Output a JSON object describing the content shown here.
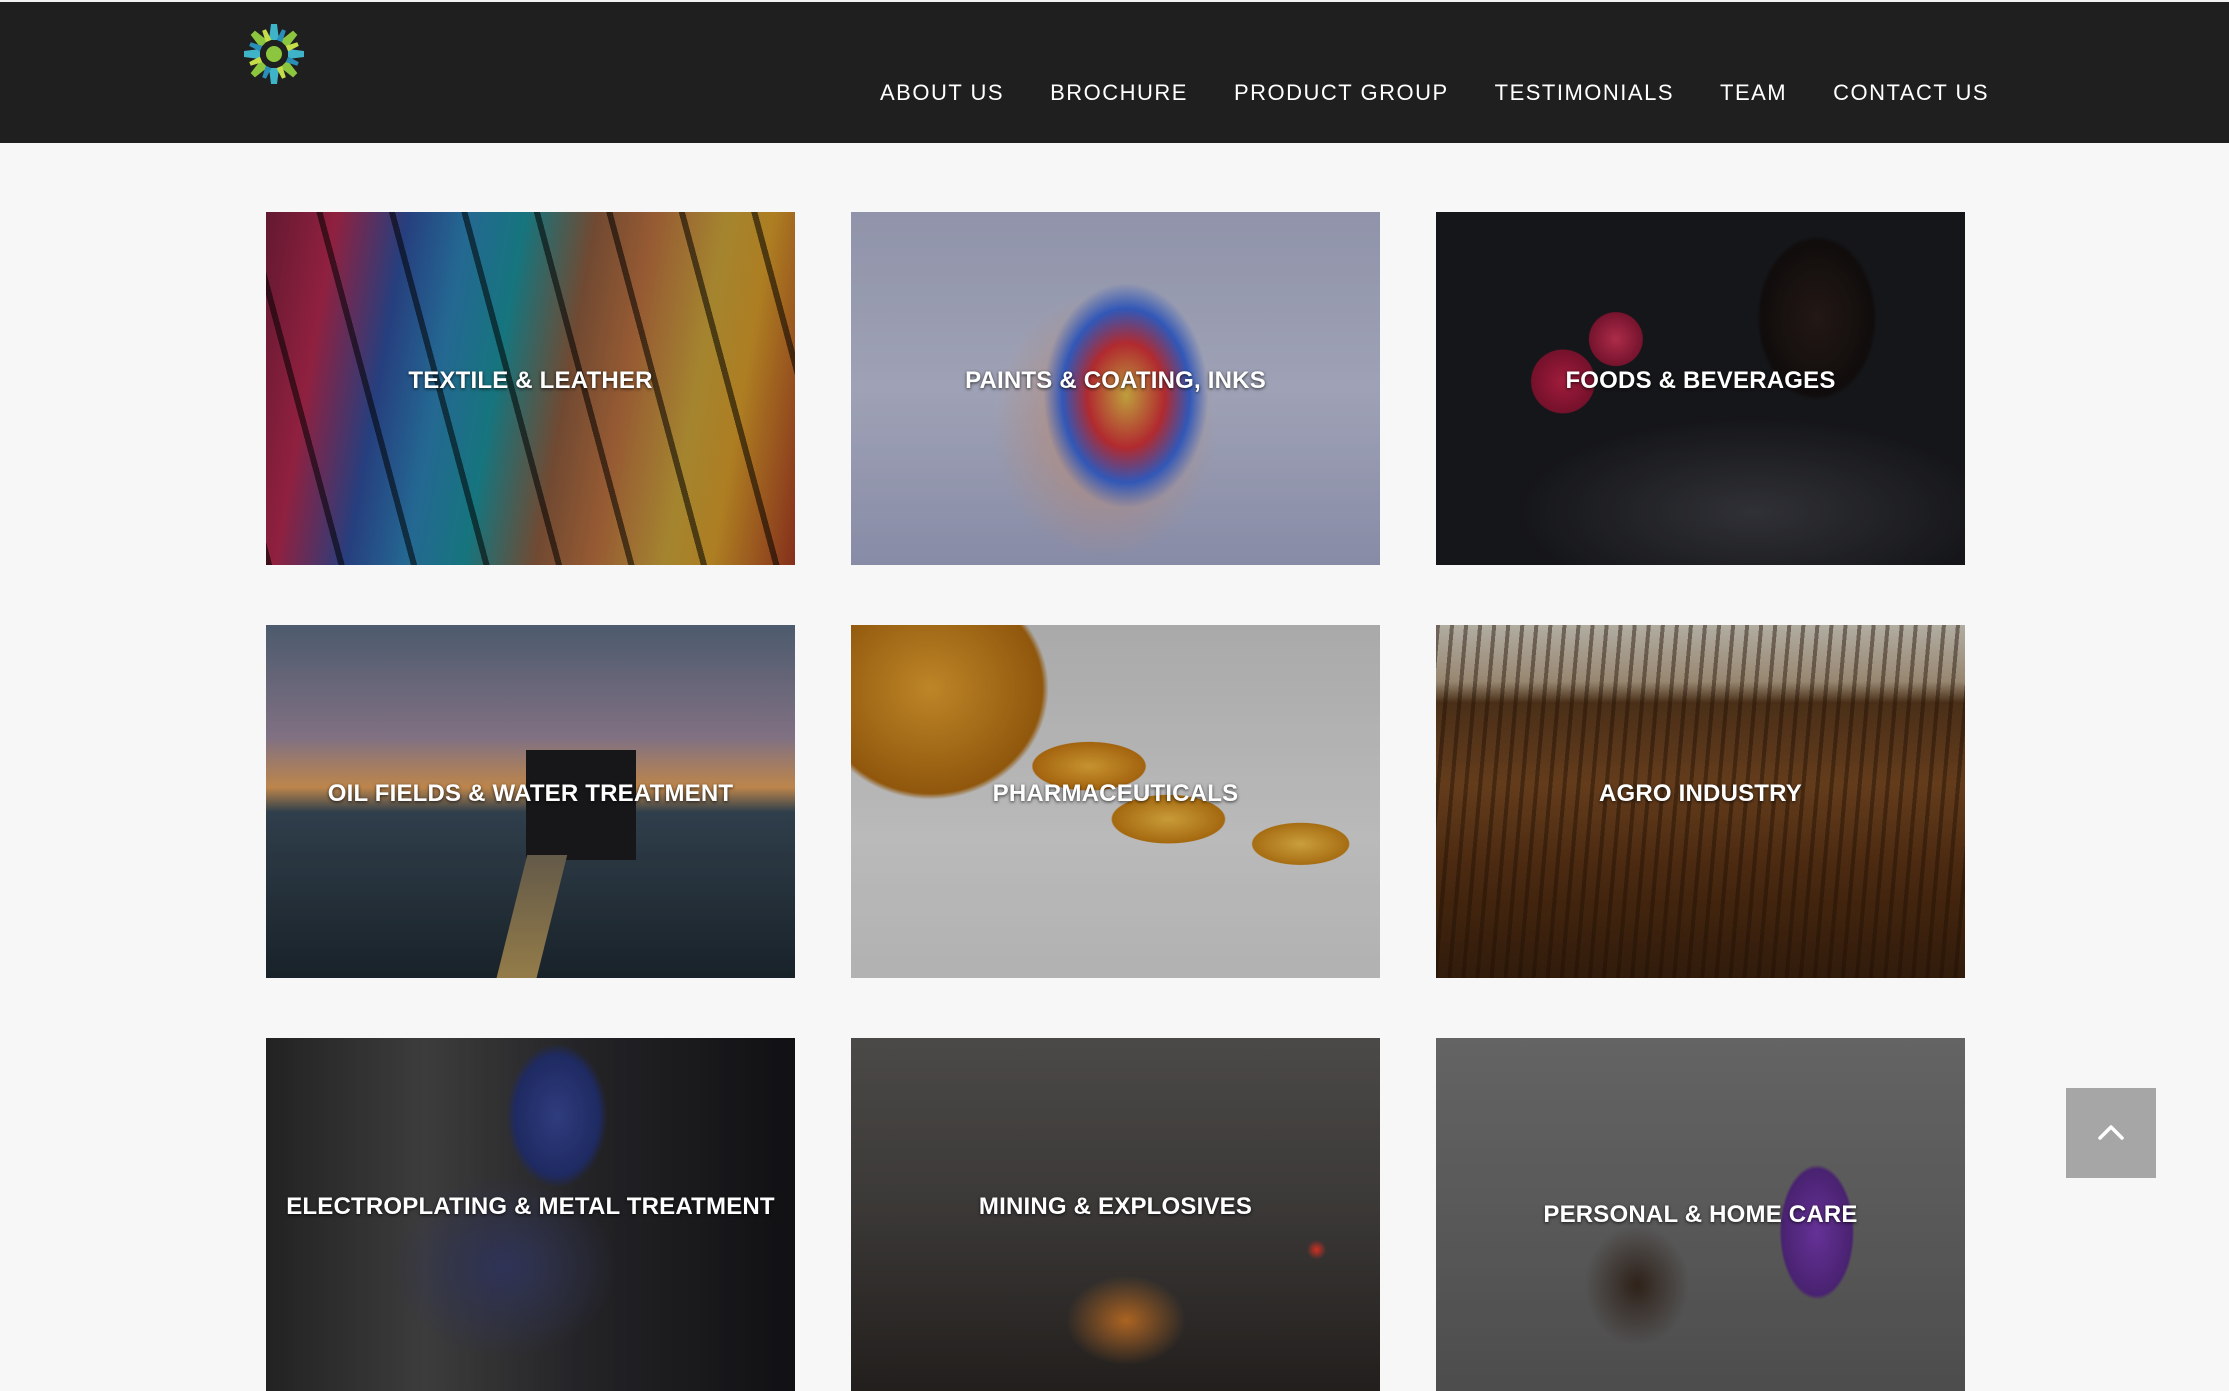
{
  "header": {
    "logo_name": "sunburst-logo",
    "nav": [
      {
        "label": "ABOUT US"
      },
      {
        "label": "BROCHURE"
      },
      {
        "label": "PRODUCT GROUP"
      },
      {
        "label": "TESTIMONIALS"
      },
      {
        "label": "TEAM"
      },
      {
        "label": "CONTACT US"
      }
    ]
  },
  "products": [
    {
      "label": "TEXTILE & LEATHER"
    },
    {
      "label": "PAINTS & COATING, INKS"
    },
    {
      "label": "FOODS & BEVERAGES"
    },
    {
      "label": "OIL FIELDS & WATER TREATMENT"
    },
    {
      "label": "PHARMACEUTICALS"
    },
    {
      "label": "AGRO INDUSTRY"
    },
    {
      "label": "ELECTROPLATING & METAL TREATMENT"
    },
    {
      "label": "MINING & EXPLOSIVES"
    },
    {
      "label": "PERSONAL & HOME CARE"
    }
  ],
  "scroll_top": {
    "icon": "chevron-up-icon"
  },
  "colors": {
    "header_bg": "#1f1f1f",
    "page_bg": "#f7f7f7",
    "logo_teal": "#3fb4c9",
    "logo_green": "#8cc63f"
  }
}
